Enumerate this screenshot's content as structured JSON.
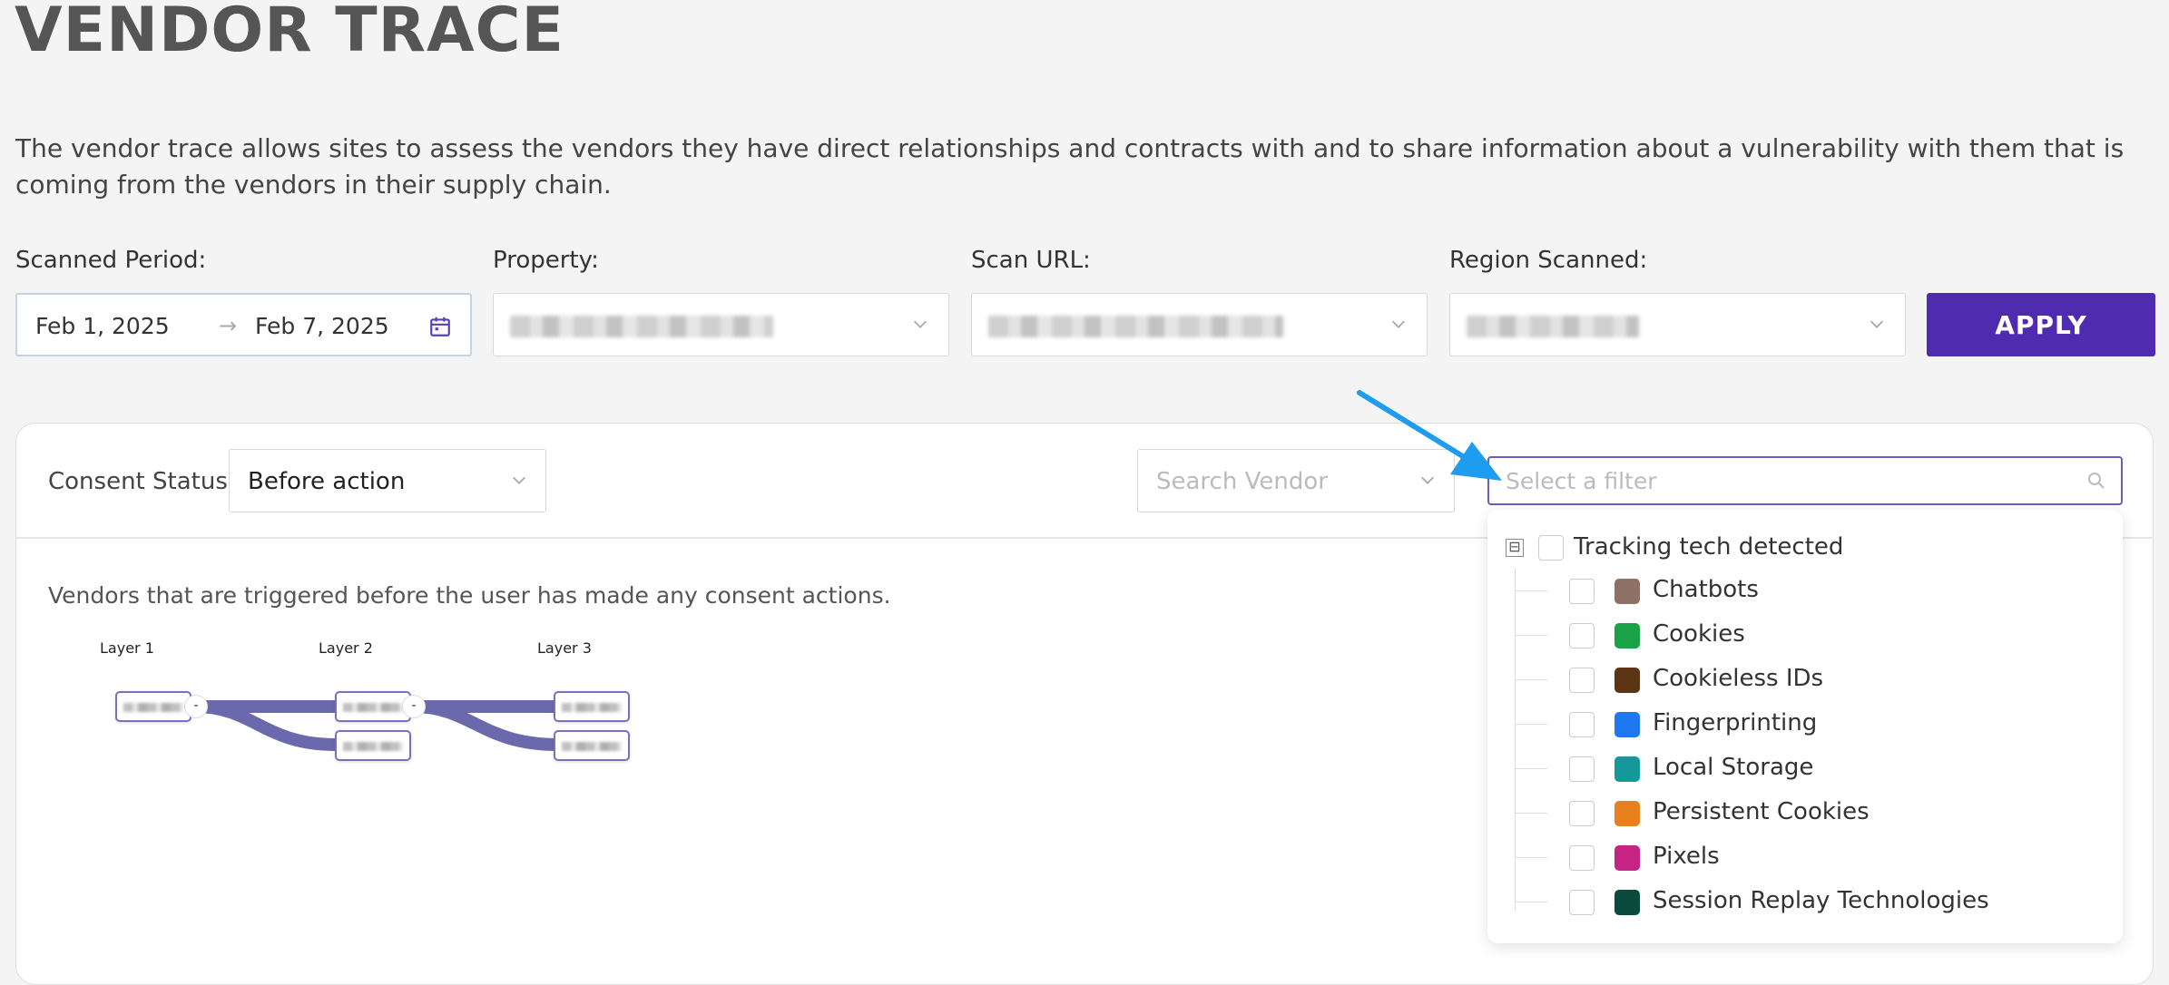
{
  "page": {
    "title": "VENDOR TRACE",
    "description": "The vendor trace allows sites to assess the vendors they have direct relationships and contracts with and to share information about a vulnerability with them that is coming from the vendors in their supply chain."
  },
  "filters": {
    "scanned_period_label": "Scanned Period:",
    "start_date": "Feb 1, 2025",
    "end_date": "Feb 7, 2025",
    "property_label": "Property:",
    "scan_url_label": "Scan URL:",
    "region_label": "Region Scanned:",
    "apply_label": "APPLY"
  },
  "consent": {
    "label": "Consent Status:",
    "value": "Before action"
  },
  "search_vendor": {
    "placeholder": "Search Vendor"
  },
  "filter_select": {
    "placeholder": "Select a filter"
  },
  "vendors_text": "Vendors that are triggered before the user has made any consent actions.",
  "tree": {
    "layers": [
      "Layer 1",
      "Layer 2",
      "Layer 3"
    ],
    "collapse_symbol": "-"
  },
  "dropdown": {
    "root_label": "Tracking tech detected",
    "expander": "⊟",
    "items": [
      {
        "label": "Chatbots",
        "color": "#8d7066"
      },
      {
        "label": "Cookies",
        "color": "#1aa346"
      },
      {
        "label": "Cookieless IDs",
        "color": "#5c3514"
      },
      {
        "label": "Fingerprinting",
        "color": "#1f78f0"
      },
      {
        "label": "Local Storage",
        "color": "#16979a"
      },
      {
        "label": "Persistent Cookies",
        "color": "#e8801b"
      },
      {
        "label": "Pixels",
        "color": "#c72384"
      },
      {
        "label": "Session Replay Technologies",
        "color": "#0b4b3d"
      }
    ]
  },
  "colors": {
    "accent": "#4f2bb0",
    "annotation_arrow": "#1e9cef",
    "tree_link": "#6b69ad"
  }
}
